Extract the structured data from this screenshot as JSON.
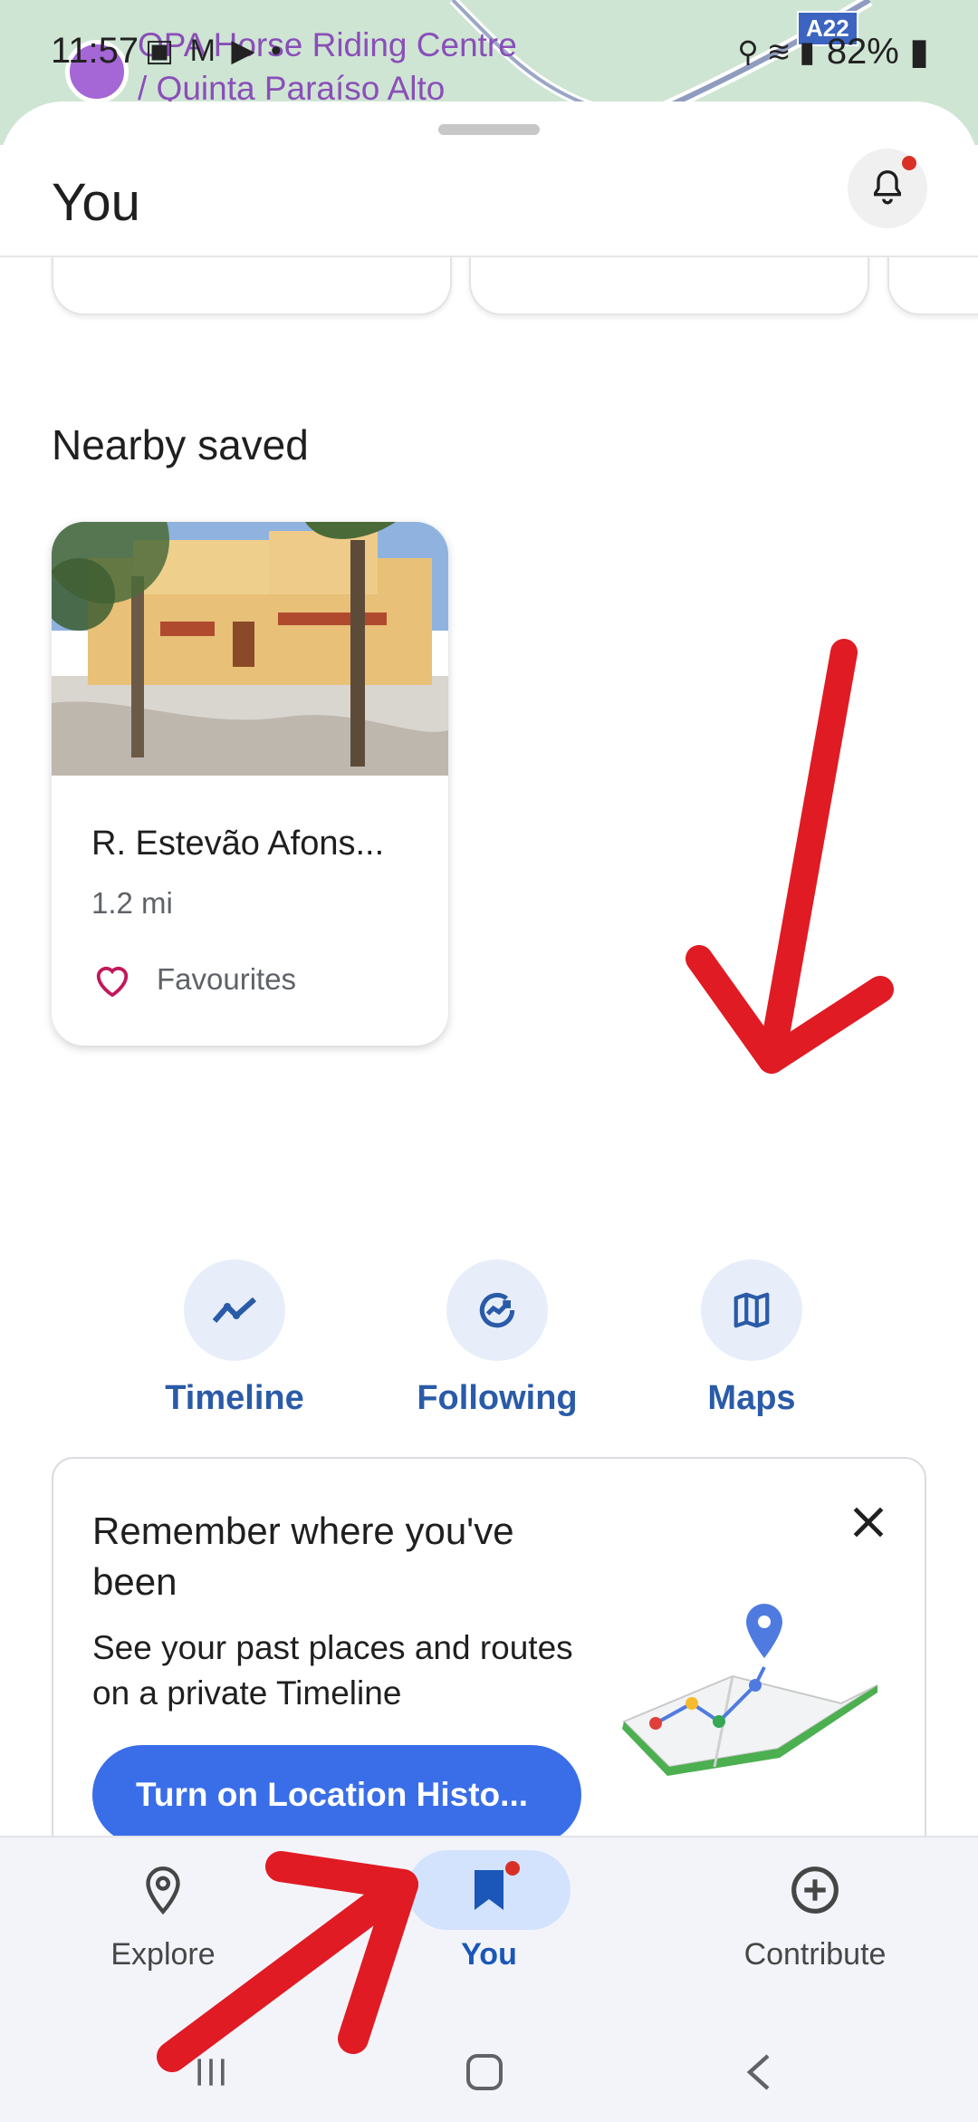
{
  "map": {
    "place_label_line1": "OPA Horse Riding Centre",
    "place_label_line2": "/ Quinta Paraíso Alto",
    "road_badge": "A22"
  },
  "status_bar": {
    "time": "11:57",
    "battery": "82%"
  },
  "header": {
    "title": "You",
    "has_notification_dot": true
  },
  "nearby": {
    "section_title": "Nearby saved",
    "cards": [
      {
        "name": "R. Estevão Afons...",
        "distance": "1.2 mi",
        "list_icon": "heart-outline-icon",
        "list_name": "Favourites"
      }
    ]
  },
  "quick_actions": [
    {
      "label": "Timeline",
      "icon": "timeline-icon"
    },
    {
      "label": "Following",
      "icon": "following-icon"
    },
    {
      "label": "Maps",
      "icon": "map-icon"
    }
  ],
  "promo": {
    "title": "Remember where you've been",
    "description": "See your past places and routes on a private Timeline",
    "button_label": "Turn on Location Histo..."
  },
  "bottom_nav": {
    "items": [
      {
        "label": "Explore",
        "icon": "location-pin-icon",
        "active": false
      },
      {
        "label": "You",
        "icon": "bookmark-icon",
        "active": true
      },
      {
        "label": "Contribute",
        "icon": "add-circle-icon",
        "active": false
      }
    ]
  },
  "colors": {
    "accent_blue": "#3a6ee8",
    "nav_active": "#1a57b8",
    "annotation_red": "#e01b24",
    "favourite_pink": "#c2185b"
  }
}
